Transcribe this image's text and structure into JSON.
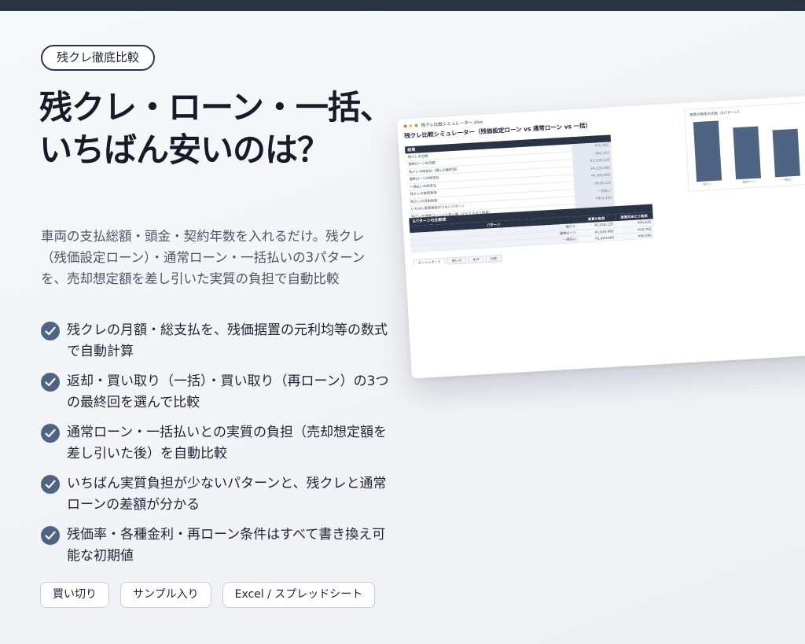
{
  "tag": "残クレ徹底比較",
  "headline": [
    "残クレ・ローン・一括、",
    "いちばん安いのは？"
  ],
  "description": "車両の支払総額・頭金・契約年数を入れるだけ。残クレ（残価設定ローン）・通常ローン・一括払いの3パターンを、売却想定額を差し引いた実質の負担で自動比較",
  "features": [
    "残クレの月額・総支払を、残価据置の元利均等の数式で自動計算",
    "返却・買い取り（一括）・買い取り（再ローン）の3つの最終回を選んで比較",
    "通常ローン・一括払いとの実質の負担（売却想定額を差し引いた後）を自動比較",
    "いちばん実質負担が少ないパターンと、残クレと通常ローンの差額が分かる",
    "残価率・各種金利・再ローン条件はすべて書き換え可能な初期値"
  ],
  "pills": [
    "買い切り",
    "サンプル入り",
    "Excel / スプレッドシート"
  ],
  "colors": {
    "accent": "#4e6482",
    "dark": "#2b3447"
  },
  "icons": {
    "feature_bullet": "check-circle-icon"
  },
  "sheet": {
    "filename": "残クレ比較シミュレーター.xlsx",
    "title": "残クレ比較シミュレーター（残価設定ローン vs 通常ローン vs 一括）",
    "summary_header": "結果",
    "summary_rows": [
      {
        "label": "残クレの月額",
        "value": "¥42,302"
      },
      {
        "label": "通常ローンの月額",
        "value": "¥62,116"
      },
      {
        "label": "残クレの総支払（選んだ最終回）",
        "value": "¥3,038,120"
      },
      {
        "label": "通常ローンの総支払",
        "value": "¥4,226,960"
      },
      {
        "label": "一括払いの総支払",
        "value": "¥4,000,000"
      },
      {
        "label": "残クレの実質負担",
        "value": "¥638,120"
      },
      {
        "label": "残クレの月割負担",
        "value": "一括払い"
      },
      {
        "label": "いちばん実質負担が少ないパターン",
        "value": "¥411,160"
      },
      {
        "label": "残クレが通常ローンより安い額（マイナスなら割高）",
        "value": ""
      }
    ],
    "compare_title": "3パターンの比較表",
    "compare_headers": [
      "パターン",
      "実質の負担",
      "実質月あたり負担"
    ],
    "compare_rows": [
      {
        "name": "残クレ",
        "burden": "¥3,038,120",
        "monthly": "¥50,635"
      },
      {
        "name": "通常ローン",
        "burden": "¥2,626,960",
        "monthly": "¥43,783"
      },
      {
        "name": "一括払い",
        "burden": "¥2,400,000",
        "monthly": "¥40,000"
      }
    ],
    "tabs": [
      "ダッシュボード",
      "使い方",
      "条件",
      "比較"
    ],
    "chart_title": "実質の負担の比較（3パターン）",
    "chart_labels": [
      "残クレ",
      "通常ローン",
      "一括払い"
    ]
  },
  "chart_data": {
    "type": "bar",
    "title": "実質の負担の比較（3パターン）",
    "categories": [
      "残クレ",
      "通常ローン",
      "一括払い"
    ],
    "values": [
      3038120,
      2626960,
      2400000
    ]
  }
}
